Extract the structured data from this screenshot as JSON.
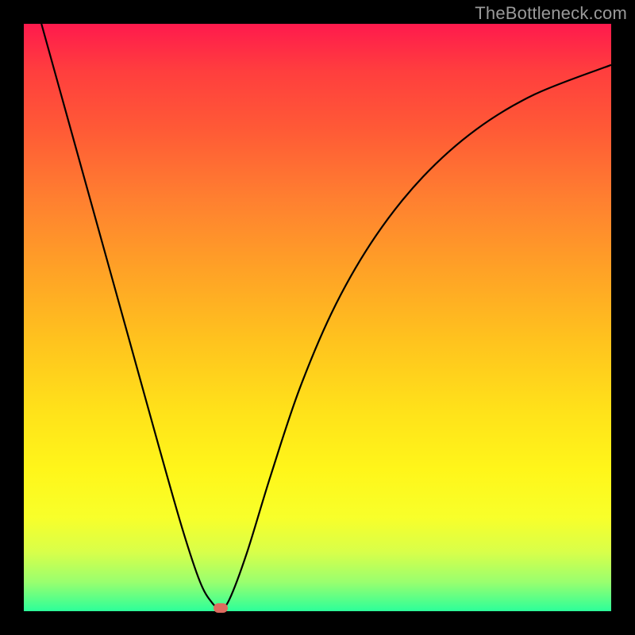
{
  "watermark": "TheBottleneck.com",
  "colors": {
    "page_bg": "#000000",
    "gradient_top": "#ff1a4d",
    "gradient_bottom": "#2cff9a",
    "curve": "#000000",
    "marker": "#dd6b5f",
    "watermark_text": "#9a9a9a"
  },
  "chart_data": {
    "type": "line",
    "title": "",
    "xlabel": "",
    "ylabel": "",
    "xlim": [
      0,
      100
    ],
    "ylim": [
      0,
      100
    ],
    "grid": false,
    "legend": false,
    "series": [
      {
        "name": "bottleneck-curve",
        "x": [
          3,
          8,
          13,
          18,
          23,
          27,
          30,
          32,
          33.5,
          35,
          38,
          42,
          47,
          53,
          60,
          68,
          77,
          87,
          100
        ],
        "y": [
          100,
          82,
          64,
          46,
          28,
          14,
          5,
          1.5,
          0.5,
          2,
          10,
          23,
          38,
          52,
          64,
          74,
          82,
          88,
          93
        ]
      }
    ],
    "marker": {
      "x": 33.5,
      "y": 0.5
    },
    "background_gradient": {
      "direction": "vertical",
      "stops": [
        {
          "pos": 0.0,
          "color": "#ff1a4d"
        },
        {
          "pos": 0.18,
          "color": "#ff5a36"
        },
        {
          "pos": 0.42,
          "color": "#ffa226"
        },
        {
          "pos": 0.66,
          "color": "#ffe21a"
        },
        {
          "pos": 0.84,
          "color": "#f8ff2a"
        },
        {
          "pos": 0.95,
          "color": "#9aff6e"
        },
        {
          "pos": 1.0,
          "color": "#2cff9a"
        }
      ]
    }
  }
}
